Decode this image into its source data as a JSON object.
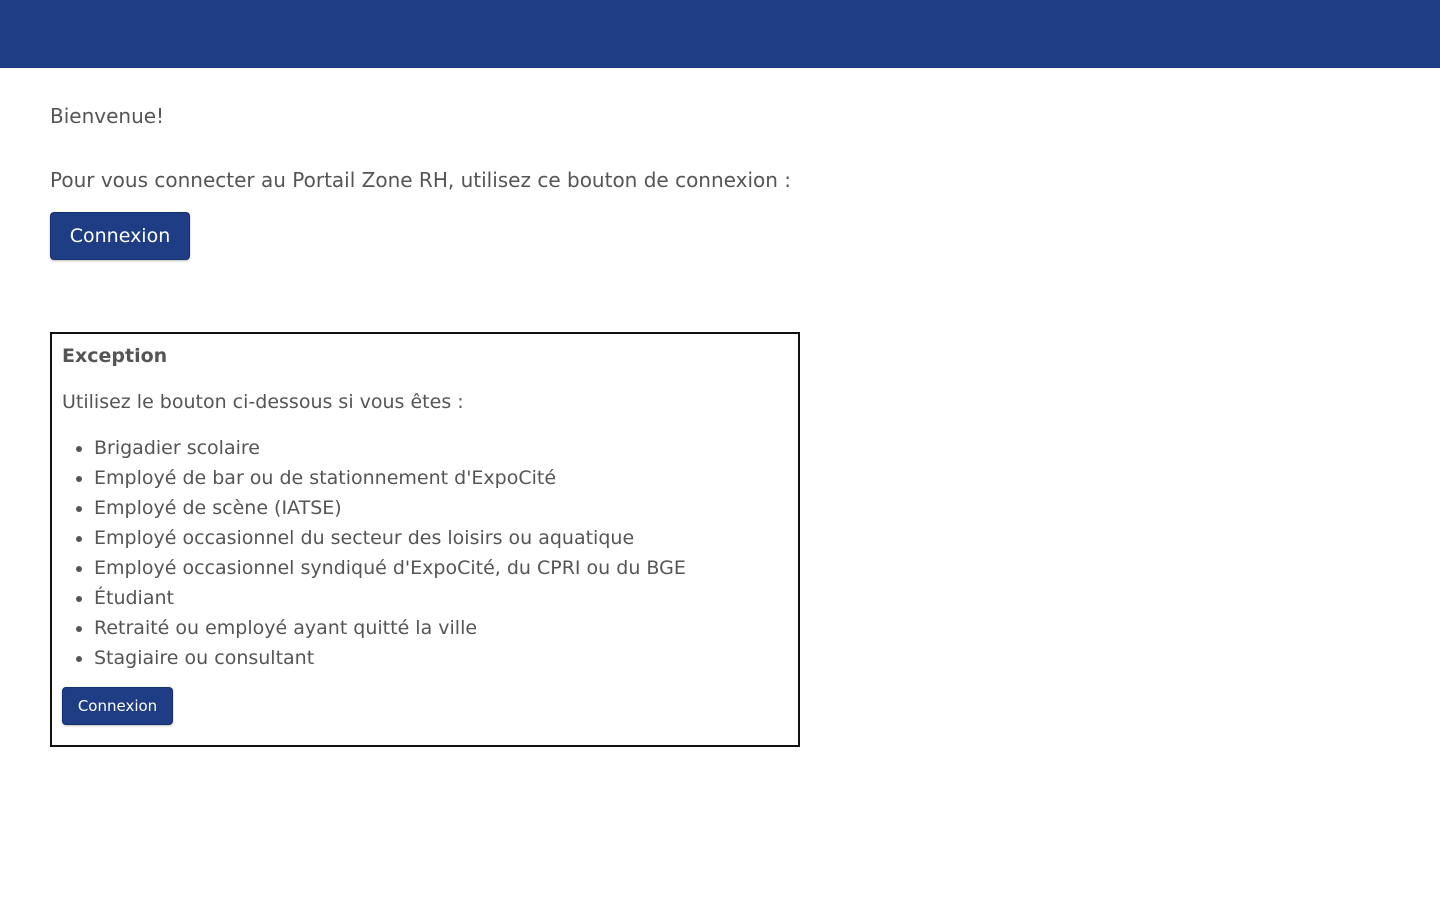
{
  "header": {
    "bar_color": "#1f3d85"
  },
  "main": {
    "welcome_text": "Bienvenue!",
    "intro_text": "Pour vous connecter au Portail Zone RH, utilisez ce bouton de connexion :",
    "login_button_label": "Connexion"
  },
  "exception": {
    "title": "Exception",
    "intro_text": "Utilisez le bouton ci-dessous si vous êtes :",
    "items": [
      "Brigadier scolaire",
      "Employé de bar ou de stationnement d'ExpoCité",
      "Employé de scène (IATSE)",
      "Employé occasionnel du secteur des loisirs ou aquatique",
      "Employé occasionnel syndiqué d'ExpoCité, du CPRI ou du BGE",
      "Étudiant",
      "Retraité ou employé ayant quitté la ville",
      "Stagiaire ou consultant"
    ],
    "login_button_label": "Connexion"
  },
  "colors": {
    "primary": "#1f3d85",
    "text": "#555555",
    "box_border": "#111111"
  }
}
